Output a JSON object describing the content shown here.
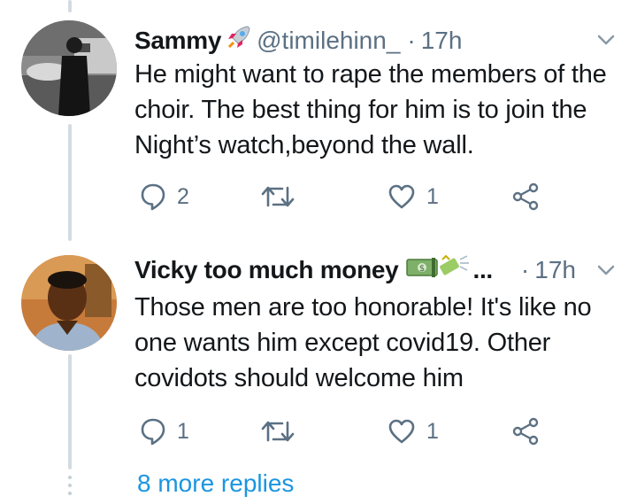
{
  "replies": [
    {
      "name": "Sammy",
      "name_emoji": "rocket-emoji",
      "handle": "@timilehinn_",
      "separator": "·",
      "time": "17h",
      "text": "He might want to rape the members of the choir. The best thing for him is to join the Night’s watch,beyond the wall.",
      "reply_count": "2",
      "like_count": "1"
    },
    {
      "name": "Vicky too much money",
      "name_emoji": "money-emojis",
      "ellipsis": "...",
      "separator": "·",
      "time": "17h",
      "text": "Those men are too honorable! It's like no one wants him except covid19. Other covidots should welcome him",
      "reply_count": "1",
      "like_count": "1"
    }
  ],
  "more_replies": "8 more replies",
  "colors": {
    "text": "#14171a",
    "muted": "#5b7083",
    "link": "#1b95e0",
    "thread": "#d4dbe1"
  }
}
